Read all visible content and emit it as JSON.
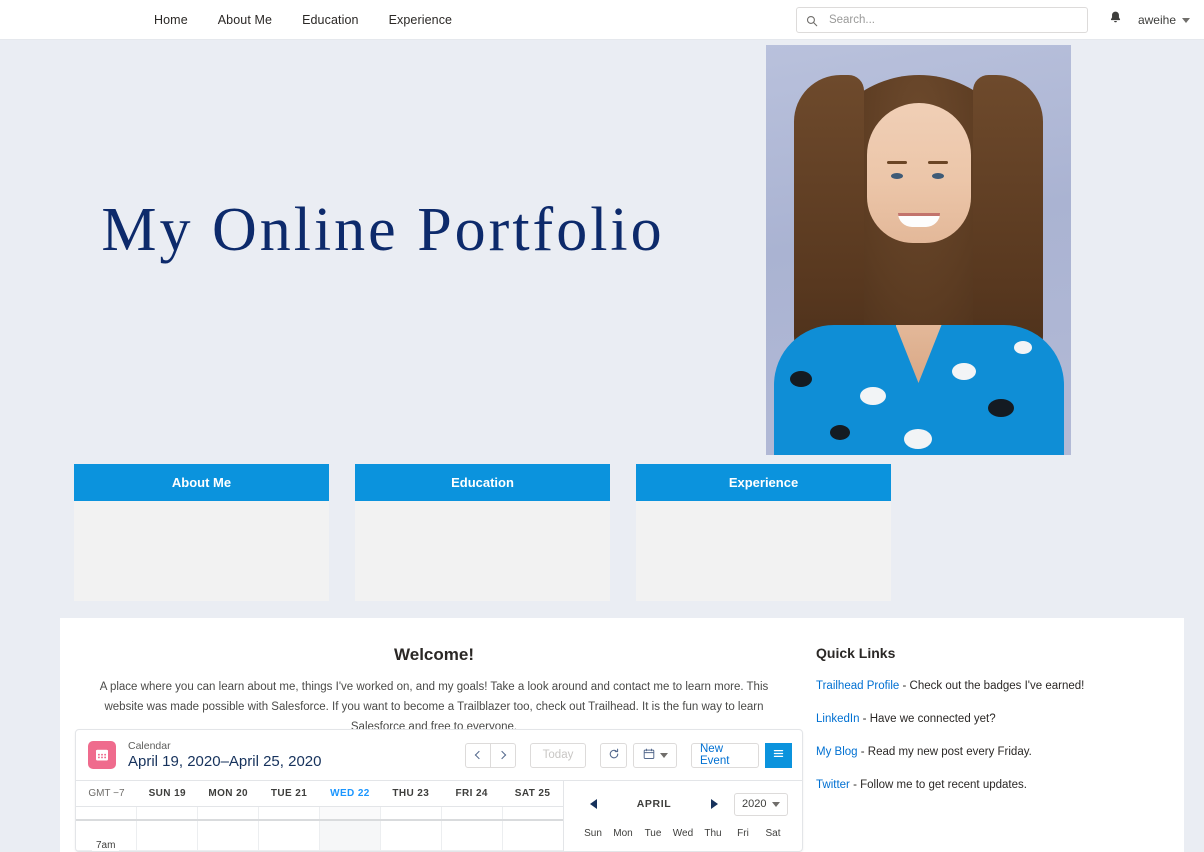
{
  "nav": {
    "links": [
      {
        "label": "Home"
      },
      {
        "label": "About Me"
      },
      {
        "label": "Education"
      },
      {
        "label": "Experience"
      }
    ],
    "search": {
      "placeholder": "Search...",
      "value": "",
      "icon": "search-icon"
    },
    "notifications_icon": "bell-icon",
    "user": {
      "name": "aweihe",
      "caret_icon": "chevron-down-icon"
    }
  },
  "hero": {
    "title": "My Online Portfolio",
    "title_color": "#0d2a6b",
    "background_color": "#eaedf3",
    "portrait_alt": "profile-photo"
  },
  "cards": [
    {
      "label": "About Me"
    },
    {
      "label": "Education"
    },
    {
      "label": "Experience"
    }
  ],
  "card_header_color": "#0b93dd",
  "welcome": {
    "title": "Welcome!",
    "body": "A place where you can learn about me, things I've worked on, and my goals! Take a look around and contact me to learn more. This website was made possible with Salesforce. If you want to become a Trailblazer too, check out Trailhead. It is the fun way to learn Salesforce and free to everyone."
  },
  "calendar": {
    "icon": "calendar-icon",
    "icon_color": "#ef6b8d",
    "subtitle": "Calendar",
    "range": "April 19, 2020–April 25, 2020",
    "toolbar": {
      "prev_icon": "chevron-left-icon",
      "next_icon": "chevron-right-icon",
      "today_label": "Today",
      "refresh_icon": "refresh-icon",
      "view_icon": "calendar-view-icon",
      "view_caret_icon": "chevron-down-icon",
      "new_event_label": "New Event",
      "menu_icon": "hamburger-menu-icon"
    },
    "week": {
      "timezone": "GMT −7",
      "days": [
        {
          "label": "SUN 19",
          "today": false
        },
        {
          "label": "MON 20",
          "today": false
        },
        {
          "label": "TUE 21",
          "today": false
        },
        {
          "label": "WED 22",
          "today": true
        },
        {
          "label": "THU 23",
          "today": false
        },
        {
          "label": "FRI 24",
          "today": false
        },
        {
          "label": "SAT 25",
          "today": false
        }
      ],
      "first_time_label": "7am"
    },
    "mini": {
      "prev_icon": "triangle-left-icon",
      "next_icon": "triangle-right-icon",
      "month": "APRIL",
      "year": "2020",
      "year_caret_icon": "chevron-down-icon",
      "dow": [
        "Sun",
        "Mon",
        "Tue",
        "Wed",
        "Thu",
        "Fri",
        "Sat"
      ]
    }
  },
  "quick_links": {
    "title": "Quick Links",
    "items": [
      {
        "link": "Trailhead Profile",
        "text": " - Check out the badges I've earned!"
      },
      {
        "link": "LinkedIn",
        "text": " - Have we connected yet?"
      },
      {
        "link": "My Blog",
        "text": " - Read my new post every Friday."
      },
      {
        "link": "Twitter",
        "text": " - Follow me to get recent updates."
      }
    ]
  }
}
